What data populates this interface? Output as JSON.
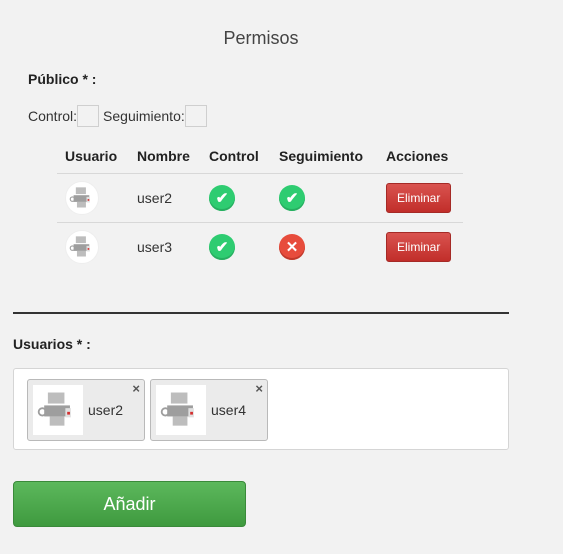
{
  "page": {
    "title": "Permisos"
  },
  "publico": {
    "label": "Público * :",
    "control_label": "Control:",
    "seguimiento_label": "Seguimiento:"
  },
  "table": {
    "headers": {
      "usuario": "Usuario",
      "nombre": "Nombre",
      "control": "Control",
      "seguimiento": "Seguimiento",
      "acciones": "Acciones"
    },
    "rows": [
      {
        "name": "user2",
        "control": true,
        "seguimiento": true,
        "action": "Eliminar"
      },
      {
        "name": "user3",
        "control": true,
        "seguimiento": false,
        "action": "Eliminar"
      }
    ]
  },
  "usuarios": {
    "label": "Usuarios * :",
    "selected": [
      {
        "name": "user2",
        "close": "×"
      },
      {
        "name": "user4",
        "close": "×"
      }
    ]
  },
  "actions": {
    "add_label": "Añadir"
  },
  "colors": {
    "ok": "#2ecc71",
    "error": "#e74c3c",
    "danger": "#c9302c",
    "primary_green": "#4cae4c"
  },
  "icons": {
    "avatar": "user-avatar-icon",
    "ok": "check-icon",
    "no": "cross-icon"
  }
}
